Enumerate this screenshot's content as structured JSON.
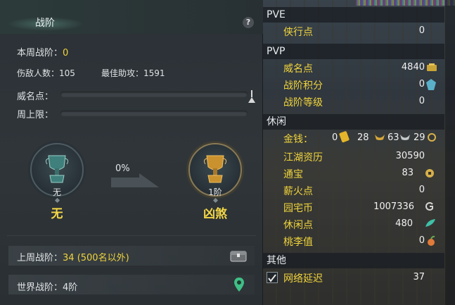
{
  "left_panel": {
    "title": "战阶",
    "help_label": "?",
    "weekly_rank_label": "本周战阶：",
    "weekly_rank_value": "0",
    "kills_label": "伤敌人数：",
    "kills_value": "105",
    "best_assist_label": "最佳助攻：",
    "best_assist_value": "1591",
    "prestige_label": "威名点：",
    "prestige_progress": 0,
    "weekly_cap_label": "周上限：",
    "weekly_cap_progress": 0,
    "current_rank": {
      "caption": "无",
      "name": "无"
    },
    "next_rank": {
      "caption": "1阶",
      "name": "凶煞"
    },
    "progress_percent": "0%",
    "last_week_label": "上周战阶：",
    "last_week_value": "34 (500名以外)",
    "world_rank_label": "世界战阶：",
    "world_rank_value": "4阶"
  },
  "right_panel": {
    "pve": {
      "header": "PVE",
      "items": [
        {
          "label": "侠行点",
          "value": "0"
        }
      ]
    },
    "pvp": {
      "header": "PVP",
      "items": [
        {
          "label": "威名点",
          "value": "4840"
        },
        {
          "label": "战阶积分",
          "value": "0"
        },
        {
          "label": "战阶等级",
          "value": "0"
        }
      ]
    },
    "leisure": {
      "header": "休闲",
      "money": {
        "label": "金钱：",
        "gold": "0",
        "silver": "28",
        "copper": "63",
        "fourth": "29"
      },
      "items": [
        {
          "label": "江湖资历",
          "value": "30590"
        },
        {
          "label": "通宝",
          "value": "83"
        },
        {
          "label": "薪火点",
          "value": "0"
        },
        {
          "label": "园宅币",
          "value": "1007336"
        },
        {
          "label": "休闲点",
          "value": "480"
        },
        {
          "label": "桃李值",
          "value": "0"
        }
      ]
    },
    "other": {
      "header": "其他",
      "latency": {
        "label": "网络延迟",
        "value": "37",
        "checked": true
      }
    }
  },
  "colors": {
    "accent_yellow": "#f0d43c",
    "panel_bg": "#2f3539"
  }
}
